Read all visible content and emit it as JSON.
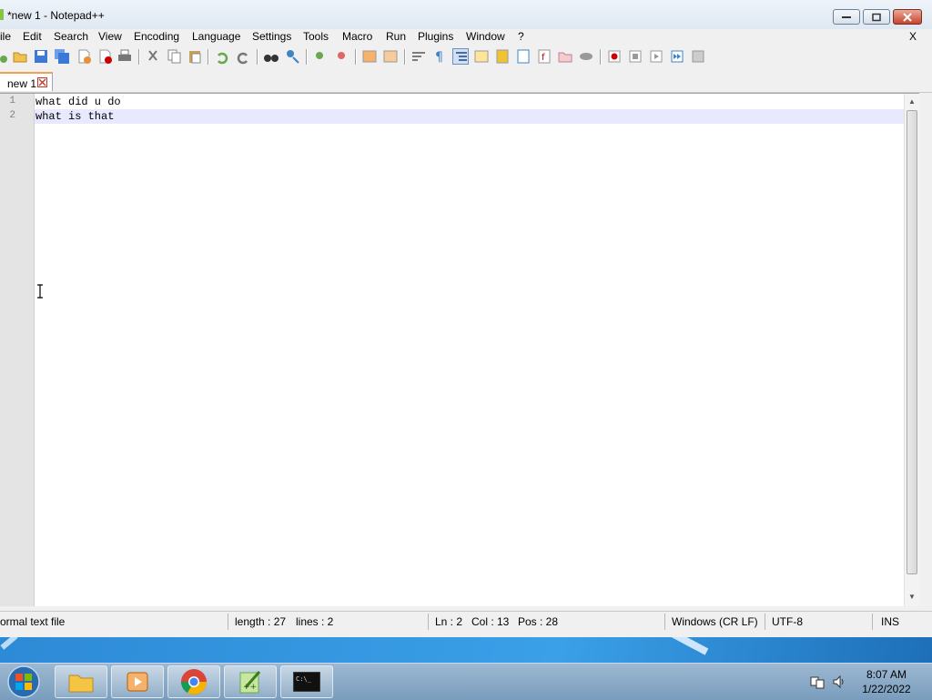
{
  "window": {
    "title": "*new 1 - Notepad++"
  },
  "menu": [
    "ile",
    "Edit",
    "Search",
    "View",
    "Encoding",
    "Language",
    "Settings",
    "Tools",
    "Macro",
    "Run",
    "Plugins",
    "Window",
    "?"
  ],
  "menu_close": "X",
  "tab": {
    "label": "new 1"
  },
  "editor": {
    "line_numbers": [
      "1",
      "2"
    ],
    "lines": [
      "what did u do",
      "what is that"
    ]
  },
  "status": {
    "file_type": "ormal text file",
    "length": "length : 27",
    "lines": "lines : 2",
    "ln": "Ln : 2",
    "col": "Col : 13",
    "pos": "Pos : 28",
    "eol": "Windows (CR LF)",
    "encoding": "UTF-8",
    "mode": "INS"
  },
  "taskbar": {
    "time": "8:07 AM",
    "date": "1/22/2022"
  },
  "colors": {
    "accent": "#f3a34a",
    "current_line": "#e8e8ff",
    "desktop": "#2d8ad6"
  }
}
